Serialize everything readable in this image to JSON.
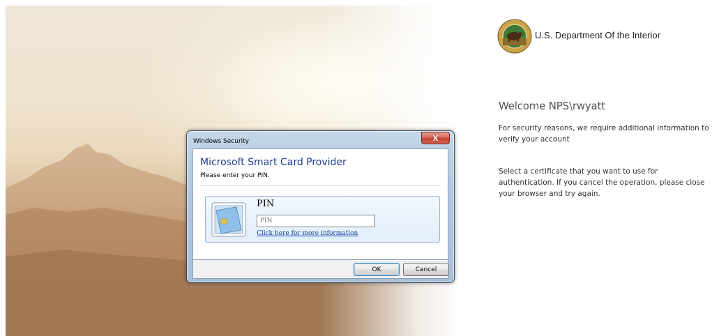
{
  "agency": {
    "name": "U.S. Department Of the Interior",
    "seal_icon": "doi-seal-icon"
  },
  "welcome": {
    "heading": "Welcome NPS\\rwyatt",
    "security_note": "For security reasons, we require additional information to verify your account",
    "instructions": "Select a certificate that you want to use for authentication. If you cancel the operation, please close your browser and try again."
  },
  "dialog": {
    "title": "Windows Security",
    "close_glyph": "X",
    "provider": "Microsoft Smart Card Provider",
    "subtitle": "Please enter your PIN.",
    "pin_label": "PIN",
    "pin_placeholder": "PIN",
    "more_info_link": "Click here for more information",
    "ok_label": "OK",
    "cancel_label": "Cancel",
    "card_icon": "smart-card-icon"
  },
  "colors": {
    "dialog_heading": "#1c3d8e",
    "link": "#0b3c9e",
    "close_button": "#c2412c"
  }
}
